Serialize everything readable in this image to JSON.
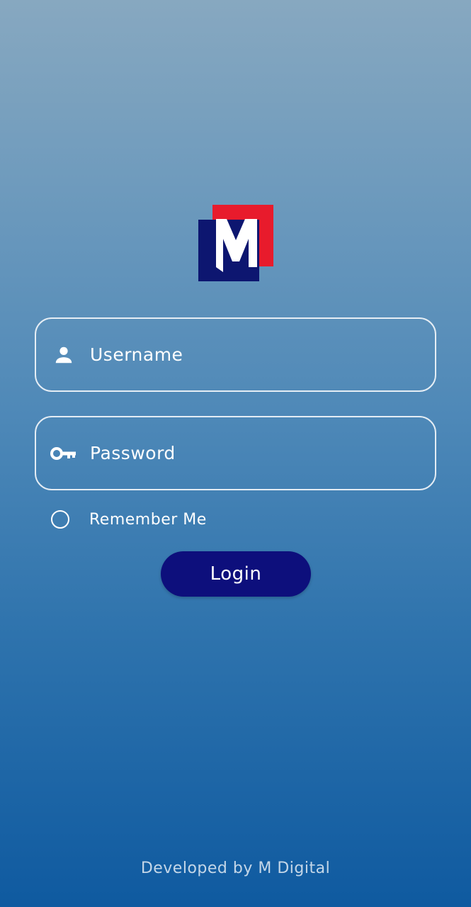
{
  "logo": {
    "icon": "m-digital-logo",
    "letter": "M",
    "colors": {
      "back_square": "#0d1670",
      "front_square": "#e81b2c",
      "letter": "#ffffff"
    }
  },
  "username": {
    "placeholder": "Username",
    "value": "",
    "icon": "person-icon"
  },
  "password": {
    "placeholder": "Password",
    "value": "",
    "icon": "key-icon"
  },
  "remember": {
    "label": "Remember Me",
    "checked": false
  },
  "login": {
    "label": "Login",
    "color": "#0d0f7c"
  },
  "footer": {
    "text": "Developed by M Digital"
  }
}
